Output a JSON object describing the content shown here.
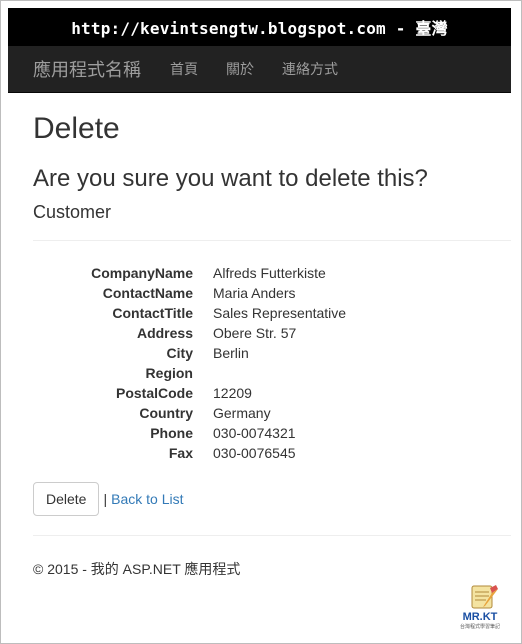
{
  "url_bar": {
    "text": "http://kevintsengtw.blogspot.com - 臺灣"
  },
  "navbar": {
    "brand": "應用程式名稱",
    "links": [
      "首頁",
      "關於",
      "連絡方式"
    ]
  },
  "page": {
    "title": "Delete",
    "question": "Are you sure you want to delete this?",
    "entity": "Customer"
  },
  "details": [
    {
      "label": "CompanyName",
      "value": "Alfreds Futterkiste"
    },
    {
      "label": "ContactName",
      "value": "Maria Anders"
    },
    {
      "label": "ContactTitle",
      "value": "Sales Representative"
    },
    {
      "label": "Address",
      "value": "Obere Str. 57"
    },
    {
      "label": "City",
      "value": "Berlin"
    },
    {
      "label": "Region",
      "value": ""
    },
    {
      "label": "PostalCode",
      "value": "12209"
    },
    {
      "label": "Country",
      "value": "Germany"
    },
    {
      "label": "Phone",
      "value": "030-0074321"
    },
    {
      "label": "Fax",
      "value": "030-0076545"
    }
  ],
  "actions": {
    "delete_label": "Delete",
    "separator": "|",
    "back_label": "Back to List"
  },
  "footer": {
    "text": "© 2015 - 我的 ASP.NET 應用程式"
  },
  "watermark": {
    "logo_text": "MR.KT",
    "subtitle": "台灣程式學習筆記",
    "icon": "notepad-pencil-icon"
  },
  "colors": {
    "navbar_bg": "#222222",
    "nav_text": "#9d9d9d",
    "link": "#337ab7",
    "url_bar_bg": "#000000"
  }
}
